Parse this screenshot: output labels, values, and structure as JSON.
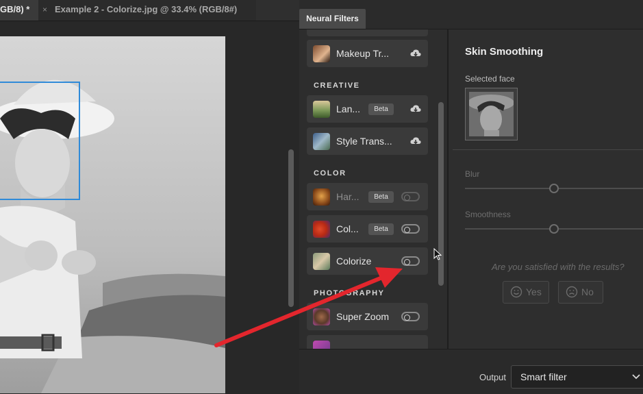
{
  "tabs": [
    {
      "label": "GB/8) *"
    },
    {
      "close_glyph": "×",
      "label": "Example 2 - Colorize.jpg @ 33.4% (RGB/8#)"
    }
  ],
  "panel": {
    "tab_label": "Neural Filters",
    "sections": {
      "creative": "CREATIVE",
      "color": "COLOR",
      "photography": "PHOTOGRAPHY"
    },
    "filters": {
      "makeup": {
        "label": "Makeup Tr...",
        "icon": "cloud-download-icon"
      },
      "landscape": {
        "label": "Lan...",
        "badge": "Beta",
        "icon": "cloud-download-icon"
      },
      "style": {
        "label": "Style Trans...",
        "icon": "cloud-download-icon"
      },
      "harmonization": {
        "label": "Har...",
        "badge": "Beta",
        "enabled": false
      },
      "color_transfer": {
        "label": "Col...",
        "badge": "Beta",
        "enabled": false
      },
      "colorize": {
        "label": "Colorize",
        "enabled": false
      },
      "super_zoom": {
        "label": "Super Zoom",
        "enabled": false
      }
    }
  },
  "details": {
    "title": "Skin Smoothing",
    "selected_face_label": "Selected face",
    "sliders": [
      {
        "label": "Blur",
        "value": 0.5
      },
      {
        "label": "Smoothness",
        "value": 0.5
      }
    ],
    "feedback_question": "Are you satisfied with the results?",
    "yes_label": "Yes",
    "no_label": "No"
  },
  "output": {
    "label": "Output",
    "value": "Smart filter"
  },
  "colors": {
    "selection_box": "#2f8ad8",
    "annotation_arrow": "#e3262d"
  }
}
